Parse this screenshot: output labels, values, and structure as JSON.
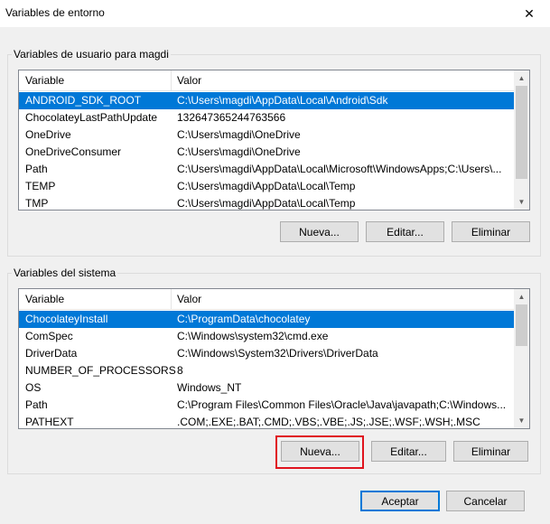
{
  "window": {
    "title": "Variables de entorno",
    "close_glyph": "✕"
  },
  "user_group": {
    "label": "Variables de usuario para magdi",
    "columns": [
      "Variable",
      "Valor"
    ],
    "rows": [
      {
        "name": "ANDROID_SDK_ROOT",
        "value": "C:\\Users\\magdi\\AppData\\Local\\Android\\Sdk",
        "selected": true
      },
      {
        "name": "ChocolateyLastPathUpdate",
        "value": "132647365244763566"
      },
      {
        "name": "OneDrive",
        "value": "C:\\Users\\magdi\\OneDrive"
      },
      {
        "name": "OneDriveConsumer",
        "value": "C:\\Users\\magdi\\OneDrive"
      },
      {
        "name": "Path",
        "value": "C:\\Users\\magdi\\AppData\\Local\\Microsoft\\WindowsApps;C:\\Users\\..."
      },
      {
        "name": "TEMP",
        "value": "C:\\Users\\magdi\\AppData\\Local\\Temp"
      },
      {
        "name": "TMP",
        "value": "C:\\Users\\magdi\\AppData\\Local\\Temp"
      }
    ],
    "buttons": {
      "new": "Nueva...",
      "edit": "Editar...",
      "delete": "Eliminar"
    }
  },
  "system_group": {
    "label": "Variables del sistema",
    "columns": [
      "Variable",
      "Valor"
    ],
    "rows": [
      {
        "name": "ChocolateyInstall",
        "value": "C:\\ProgramData\\chocolatey",
        "selected": true
      },
      {
        "name": "ComSpec",
        "value": "C:\\Windows\\system32\\cmd.exe"
      },
      {
        "name": "DriverData",
        "value": "C:\\Windows\\System32\\Drivers\\DriverData"
      },
      {
        "name": "NUMBER_OF_PROCESSORS",
        "value": "8"
      },
      {
        "name": "OS",
        "value": "Windows_NT"
      },
      {
        "name": "Path",
        "value": "C:\\Program Files\\Common Files\\Oracle\\Java\\javapath;C:\\Windows..."
      },
      {
        "name": "PATHEXT",
        "value": ".COM;.EXE;.BAT;.CMD;.VBS;.VBE;.JS;.JSE;.WSF;.WSH;.MSC"
      }
    ],
    "buttons": {
      "new": "Nueva...",
      "edit": "Editar...",
      "delete": "Eliminar"
    }
  },
  "footer": {
    "accept": "Aceptar",
    "cancel": "Cancelar"
  },
  "colors": {
    "selection": "#0078d7",
    "highlight_box": "#e0141e"
  }
}
